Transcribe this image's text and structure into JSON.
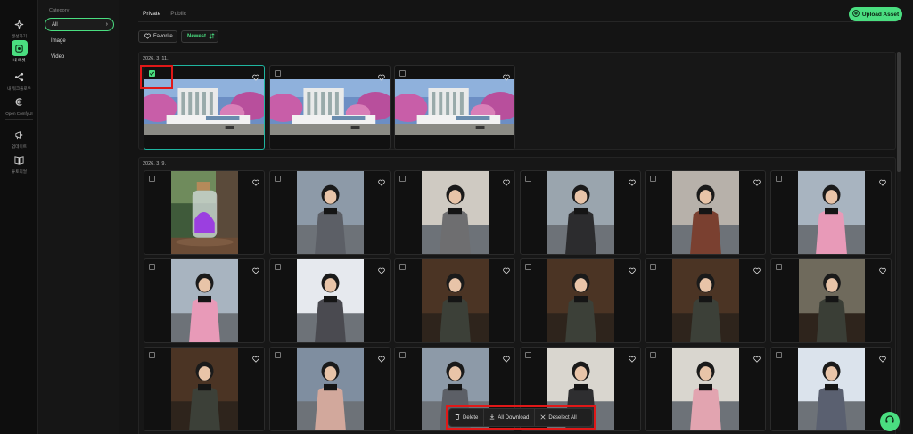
{
  "rail": {
    "items": [
      {
        "label": "생성하기",
        "icon": "sparkle-icon"
      },
      {
        "label": "내 에셋",
        "icon": "assets-icon",
        "active": true
      },
      {
        "label": "내 워크플로우",
        "icon": "workflow-icon"
      },
      {
        "label": "Open ComfyUI",
        "icon": "comfyui-icon"
      },
      {
        "label": "업데이트",
        "icon": "megaphone-icon"
      },
      {
        "label": "튜토리얼",
        "icon": "book-icon"
      }
    ]
  },
  "category": {
    "title": "Category",
    "items": [
      {
        "label": "All",
        "active": true
      },
      {
        "label": "Image"
      },
      {
        "label": "Video"
      }
    ]
  },
  "tabs": [
    {
      "label": "Private",
      "active": true
    },
    {
      "label": "Public"
    }
  ],
  "upload": {
    "label": "Upload Asset"
  },
  "filters": {
    "favorite": "Favorite",
    "newest": "Newest"
  },
  "sections": [
    {
      "date": "2026. 3. 11.",
      "items": [
        {
          "kind": "building",
          "selected": true
        },
        {
          "kind": "building"
        },
        {
          "kind": "building"
        }
      ]
    },
    {
      "date": "2026. 3. 9.",
      "items": [
        {
          "kind": "jar"
        },
        {
          "kind": "street-girl"
        },
        {
          "kind": "wall-girl"
        },
        {
          "kind": "hat-girl"
        },
        {
          "kind": "phone-girl"
        },
        {
          "kind": "pink-girl"
        },
        {
          "kind": "pink-girl"
        },
        {
          "kind": "snow-girl"
        },
        {
          "kind": "car-girl"
        },
        {
          "kind": "car-girl"
        },
        {
          "kind": "car-girl"
        },
        {
          "kind": "car-wide"
        },
        {
          "kind": "car-girl"
        },
        {
          "kind": "dress-girl"
        },
        {
          "kind": "street-girl"
        },
        {
          "kind": "mirror-girl"
        },
        {
          "kind": "mirror-pink"
        },
        {
          "kind": "snow-hat"
        }
      ]
    }
  ],
  "actions": {
    "delete": "Delete",
    "download": "All Download",
    "deselect": "Deselect All"
  },
  "colors": {
    "accent": "#4ade80",
    "selected_border": "#1fb5a0",
    "highlight": "#e01818"
  }
}
